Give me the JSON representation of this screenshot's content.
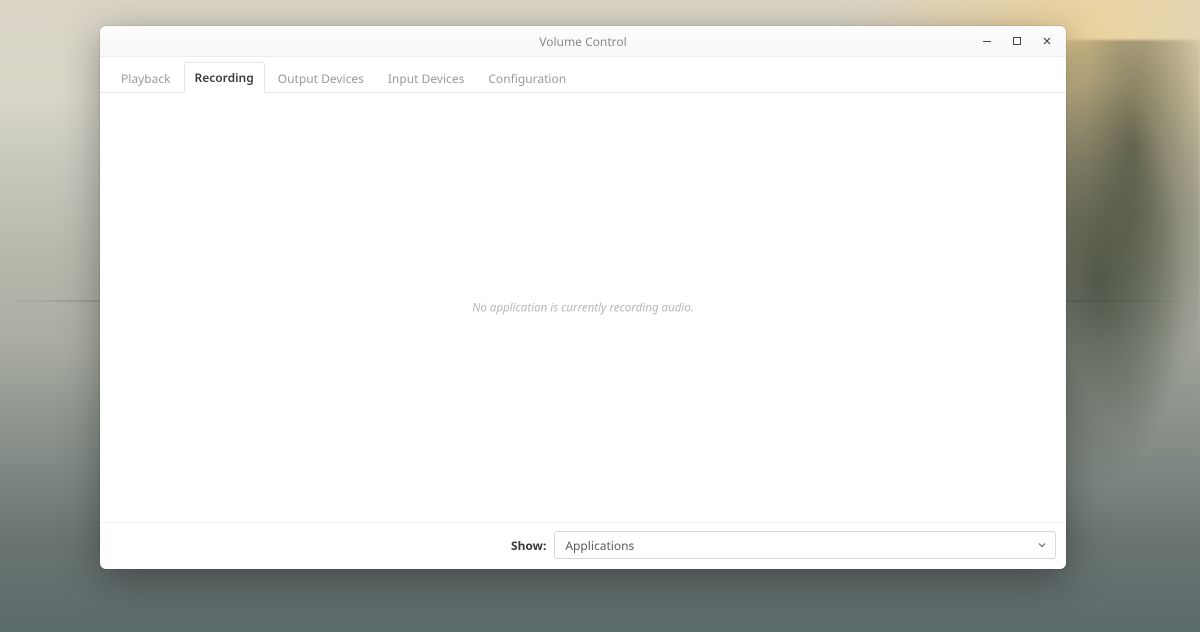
{
  "window": {
    "title": "Volume Control"
  },
  "tabs": [
    {
      "id": "playback",
      "label": "Playback",
      "active": false
    },
    {
      "id": "recording",
      "label": "Recording",
      "active": true
    },
    {
      "id": "output-devices",
      "label": "Output Devices",
      "active": false
    },
    {
      "id": "input-devices",
      "label": "Input Devices",
      "active": false
    },
    {
      "id": "configuration",
      "label": "Configuration",
      "active": false
    }
  ],
  "content": {
    "empty_message": "No application is currently recording audio."
  },
  "footer": {
    "show_label": "Show:",
    "show_value": "Applications"
  }
}
